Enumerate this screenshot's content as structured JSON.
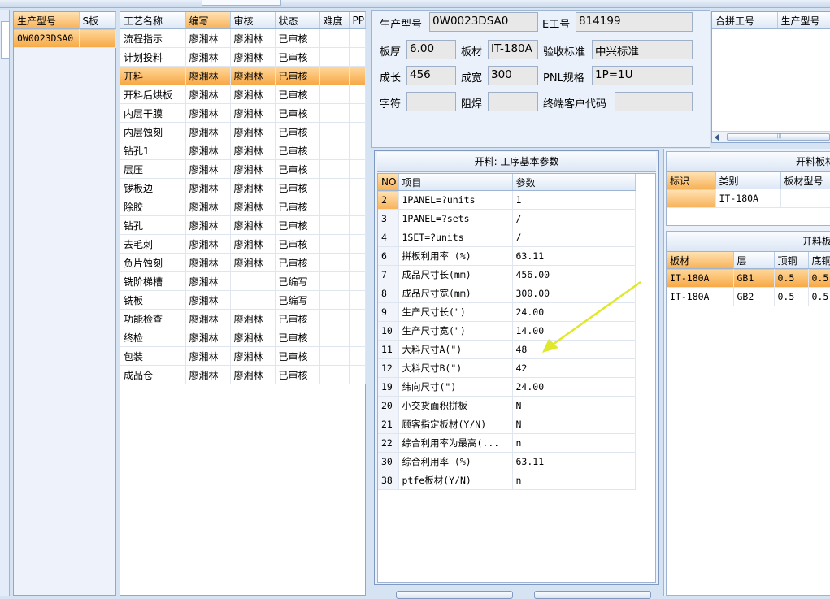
{
  "left_grid": {
    "headers": [
      "生产型号",
      "S板"
    ],
    "rows": [
      [
        "0W0023DSA0",
        ""
      ]
    ]
  },
  "process_grid": {
    "headers": [
      "工艺名称",
      "编写",
      "审核",
      "状态",
      "难度",
      "PP"
    ],
    "rows": [
      [
        "流程指示",
        "廖湘林",
        "廖湘林",
        "已审核"
      ],
      [
        "计划投料",
        "廖湘林",
        "廖湘林",
        "已审核"
      ],
      [
        "开料",
        "廖湘林",
        "廖湘林",
        "已审核"
      ],
      [
        "开料后烘板",
        "廖湘林",
        "廖湘林",
        "已审核"
      ],
      [
        "内层干膜",
        "廖湘林",
        "廖湘林",
        "已审核"
      ],
      [
        "内层蚀刻",
        "廖湘林",
        "廖湘林",
        "已审核"
      ],
      [
        "钻孔1",
        "廖湘林",
        "廖湘林",
        "已审核"
      ],
      [
        "层压",
        "廖湘林",
        "廖湘林",
        "已审核"
      ],
      [
        "锣板边",
        "廖湘林",
        "廖湘林",
        "已审核"
      ],
      [
        "除胶",
        "廖湘林",
        "廖湘林",
        "已审核"
      ],
      [
        "钻孔",
        "廖湘林",
        "廖湘林",
        "已审核"
      ],
      [
        "去毛刺",
        "廖湘林",
        "廖湘林",
        "已审核"
      ],
      [
        "负片蚀刻",
        "廖湘林",
        "廖湘林",
        "已审核"
      ],
      [
        "铣阶梯槽",
        "廖湘林",
        "",
        "已编写"
      ],
      [
        "铣板",
        "廖湘林",
        "",
        "已编写"
      ],
      [
        "功能检查",
        "廖湘林",
        "廖湘林",
        "已审核"
      ],
      [
        "终检",
        "廖湘林",
        "廖湘林",
        "已审核"
      ],
      [
        "包装",
        "廖湘林",
        "廖湘林",
        "已审核"
      ],
      [
        "成品仓",
        "廖湘林",
        "廖湘林",
        "已审核"
      ]
    ],
    "selected_index": 2
  },
  "info": {
    "model_label": "生产型号",
    "model_value": "0W0023DSA0",
    "e_label": "E工号",
    "e_value": "814199",
    "thickness_label": "板厚",
    "thickness_value": "6.00",
    "material_label": "板材",
    "material_value": "IT-180A",
    "standard_label": "验收标准",
    "standard_value": "中兴标准",
    "length_label": "成长",
    "length_value": "456",
    "width_label": "成宽",
    "width_value": "300",
    "pnl_label": "PNL规格",
    "pnl_value": "1P=1U",
    "char_label": "字符",
    "char_value": "",
    "mask_label": "阻焊",
    "mask_value": "",
    "customer_label": "终端客户代码",
    "customer_value": ""
  },
  "merge_grid": {
    "headers": [
      "合拼工号",
      "生产型号"
    ]
  },
  "params": {
    "title": "开料: 工序基本参数",
    "headers": [
      "NO",
      "项目",
      "参数"
    ],
    "rows": [
      [
        "2",
        "1PANEL=?units",
        "1"
      ],
      [
        "3",
        "1PANEL=?sets",
        "/"
      ],
      [
        "4",
        "1SET=?units",
        "/"
      ],
      [
        "6",
        "拼板利用率 (%)",
        "63.11"
      ],
      [
        "7",
        "成品尺寸长(mm)",
        "456.00"
      ],
      [
        "8",
        "成品尺寸宽(mm)",
        "300.00"
      ],
      [
        "9",
        "生产尺寸长(\")",
        "24.00"
      ],
      [
        "10",
        "生产尺寸宽(\")",
        "14.00"
      ],
      [
        "11",
        "大料尺寸A(\")",
        "48"
      ],
      [
        "12",
        "大料尺寸B(\")",
        "42"
      ],
      [
        "19",
        "纬向尺寸(\")",
        "24.00"
      ],
      [
        "20",
        "小交货面积拼板",
        "N"
      ],
      [
        "21",
        "顾客指定板材(Y/N)",
        "N"
      ],
      [
        "22",
        "综合利用率为最高(...",
        "n"
      ],
      [
        "30",
        "综合利用率 (%)",
        "63.11"
      ],
      [
        "38",
        "ptfe板材(Y/N)",
        "n"
      ]
    ]
  },
  "board_panel": {
    "title": "开料板材铝片",
    "headers": [
      "标识",
      "类别",
      "板材型号"
    ],
    "rows": [
      [
        "",
        "IT-180A",
        ""
      ]
    ]
  },
  "copper_panel": {
    "title": "开料板材信",
    "headers": [
      "板材",
      "层",
      "顶铜",
      "底铜"
    ],
    "rows": [
      [
        "IT-180A",
        "GB1",
        "0.5",
        "0.5"
      ],
      [
        "IT-180A",
        "GB2",
        "0.5",
        "0.5"
      ]
    ]
  },
  "colors": {
    "selection": "#f7a845",
    "arrow": "#e0e82a"
  }
}
